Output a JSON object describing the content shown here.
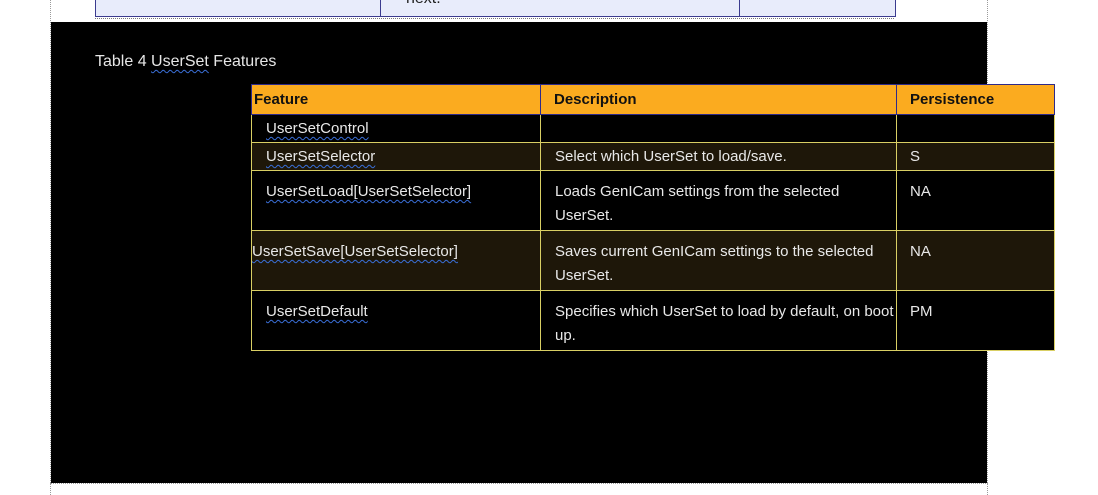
{
  "previous_table": {
    "fragment_text": "next."
  },
  "caption": {
    "prefix": "Table 4 ",
    "name": "UserSet",
    "suffix": " Features"
  },
  "table": {
    "headers": {
      "feature": "Feature",
      "description": "Description",
      "persistence": "Persistence"
    },
    "rows": [
      {
        "feature": "UserSetControl",
        "description": "",
        "persistence": ""
      },
      {
        "feature": "UserSetSelector",
        "description": "Select which UserSet to load/save.",
        "persistence": "S"
      },
      {
        "feature": "UserSetLoad[UserSetSelector]",
        "description": "Loads GenICam settings from the selected UserSet.",
        "persistence": "NA"
      },
      {
        "feature": "UserSetSave[UserSetSelector]",
        "description": "Saves current GenICam settings to the selected UserSet.",
        "persistence": "NA"
      },
      {
        "feature": "UserSetDefault",
        "description": "Specifies which UserSet to load by default, on boot up.",
        "persistence": "PM"
      }
    ]
  },
  "colors": {
    "header_fill": "#fbab1f",
    "row_border": "#d9cf64",
    "alt_row_fill": "#1e1709",
    "page_background": "#000000"
  }
}
